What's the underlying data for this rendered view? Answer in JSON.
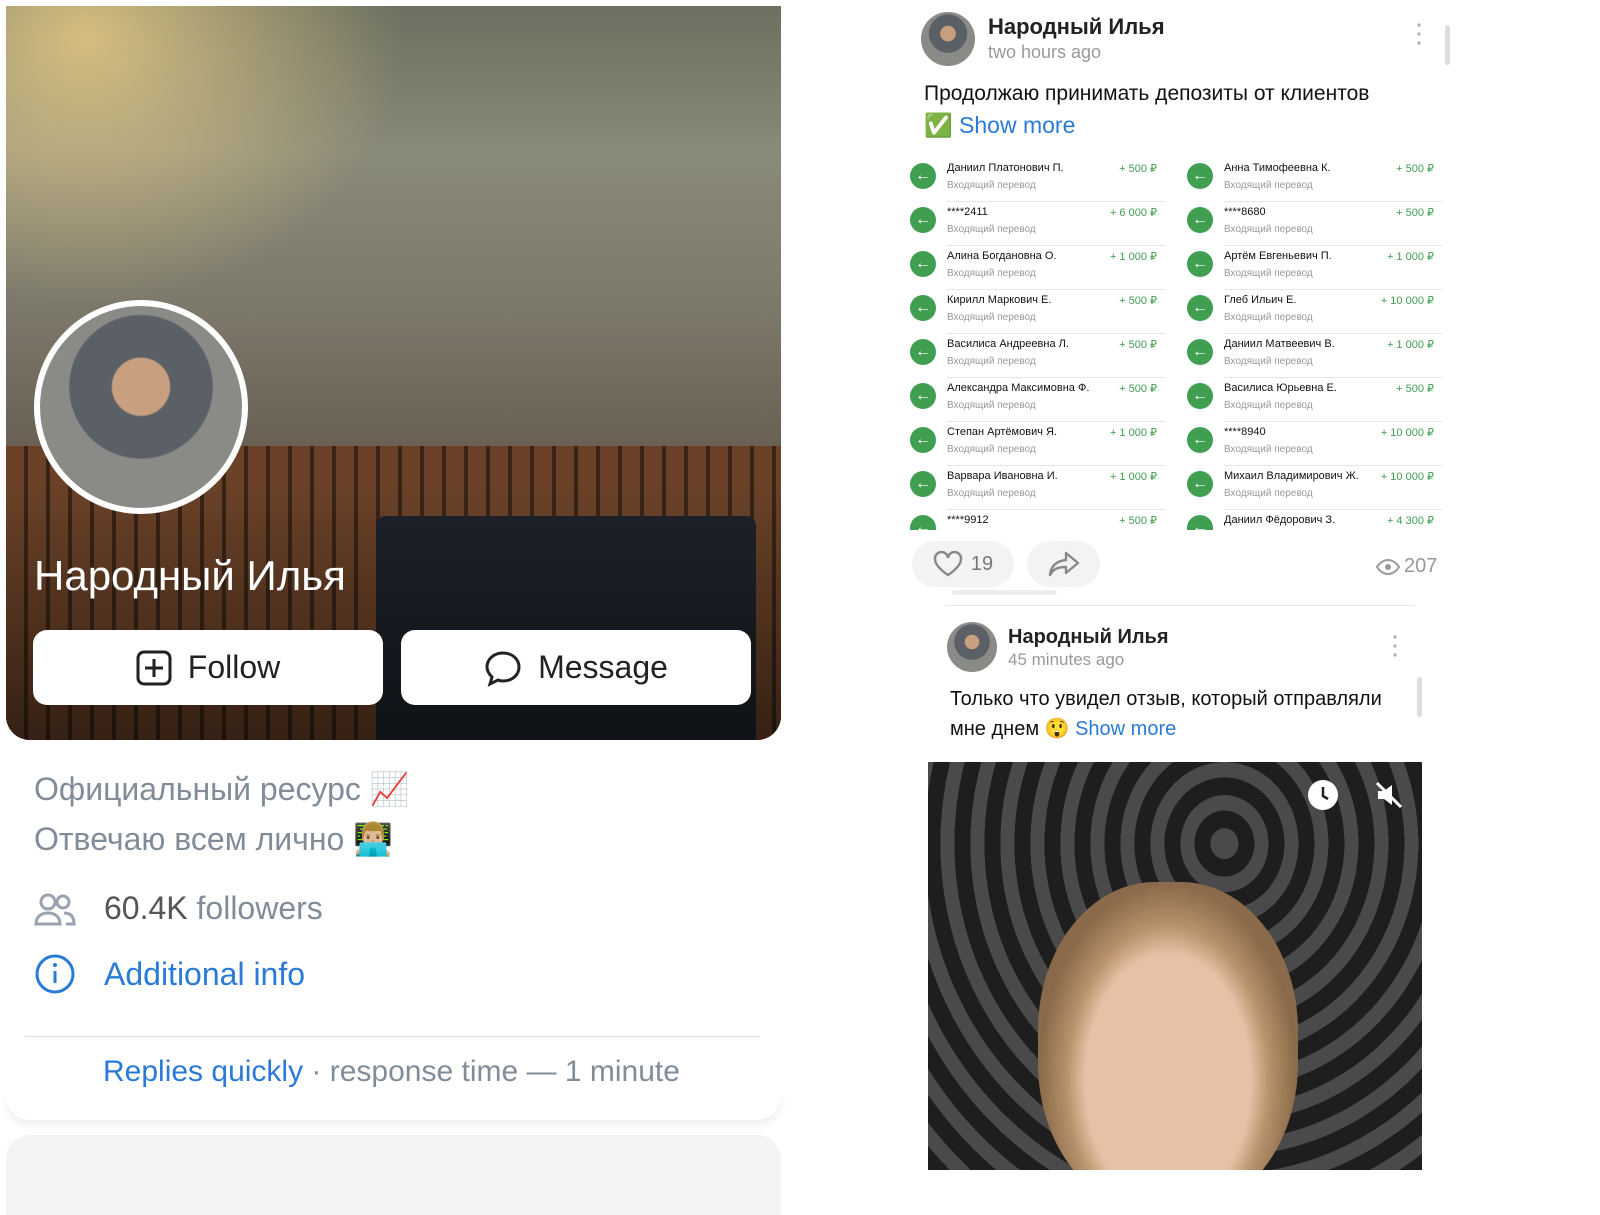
{
  "profile": {
    "name": "Народный Илья",
    "follow_label": "Follow",
    "message_label": "Message",
    "description_lines": [
      "Официальный ресурс 📈",
      "Отвечаю всем лично 👨🏼‍💻"
    ],
    "followers_count": "60.4K",
    "followers_label": "followers",
    "additional_info": "Additional info",
    "replies_quickly": "Replies quickly",
    "response_time": " · response time — 1 minute"
  },
  "post1": {
    "author": "Народный Илья",
    "time": "two hours ago",
    "text": "Продолжаю принимать депозиты от клиентов",
    "emoji": "✅",
    "show_more": "Show more",
    "likes": "19",
    "views": "207",
    "transactions_left": [
      {
        "name": "Даниил Платонович П.",
        "amount": "+ 500 ₽",
        "type": "Входящий перевод"
      },
      {
        "name": "****2411",
        "amount": "+ 6 000 ₽",
        "type": "Входящий перевод"
      },
      {
        "name": "Алина Богдановна О.",
        "amount": "+ 1 000 ₽",
        "type": "Входящий перевод"
      },
      {
        "name": "Кирилл Маркович Е.",
        "amount": "+ 500 ₽",
        "type": "Входящий перевод"
      },
      {
        "name": "Василиса Андреевна Л.",
        "amount": "+ 500 ₽",
        "type": "Входящий перевод"
      },
      {
        "name": "Александра Максимовна Ф.",
        "amount": "+ 500 ₽",
        "type": "Входящий перевод"
      },
      {
        "name": "Степан Артёмович Я.",
        "amount": "+ 1 000 ₽",
        "type": "Входящий перевод"
      },
      {
        "name": "Варвара Ивановна И.",
        "amount": "+ 1 000 ₽",
        "type": "Входящий перевод"
      },
      {
        "name": "****9912",
        "amount": "+ 500 ₽",
        "type": ""
      }
    ],
    "transactions_right": [
      {
        "name": "Анна Тимофеевна К.",
        "amount": "+ 500 ₽",
        "type": "Входящий перевод"
      },
      {
        "name": "****8680",
        "amount": "+ 500 ₽",
        "type": "Входящий перевод"
      },
      {
        "name": "Артём Евгеньевич П.",
        "amount": "+ 1 000 ₽",
        "type": "Входящий перевод"
      },
      {
        "name": "Глеб Ильич Е.",
        "amount": "+ 10 000 ₽",
        "type": "Входящий перевод"
      },
      {
        "name": "Даниил Матвеевич В.",
        "amount": "+ 1 000 ₽",
        "type": "Входящий перевод"
      },
      {
        "name": "Василиса Юрьевна Е.",
        "amount": "+ 500 ₽",
        "type": "Входящий перевод"
      },
      {
        "name": "****8940",
        "amount": "+ 10 000 ₽",
        "type": "Входящий перевод"
      },
      {
        "name": "Михаил Владимирович Ж.",
        "amount": "+ 10 000 ₽",
        "type": "Входящий перевод"
      },
      {
        "name": "Даниил Фёдорович З.",
        "amount": "+ 4 300 ₽",
        "type": ""
      }
    ]
  },
  "post2": {
    "author": "Народный Илья",
    "time": "45 minutes ago",
    "text": "Только что увидел отзыв, который отправляли мне днем 😲",
    "show_more": "Show more"
  },
  "colors": {
    "accent": "#2a7ad8",
    "transfer_green": "#3f9e50"
  }
}
